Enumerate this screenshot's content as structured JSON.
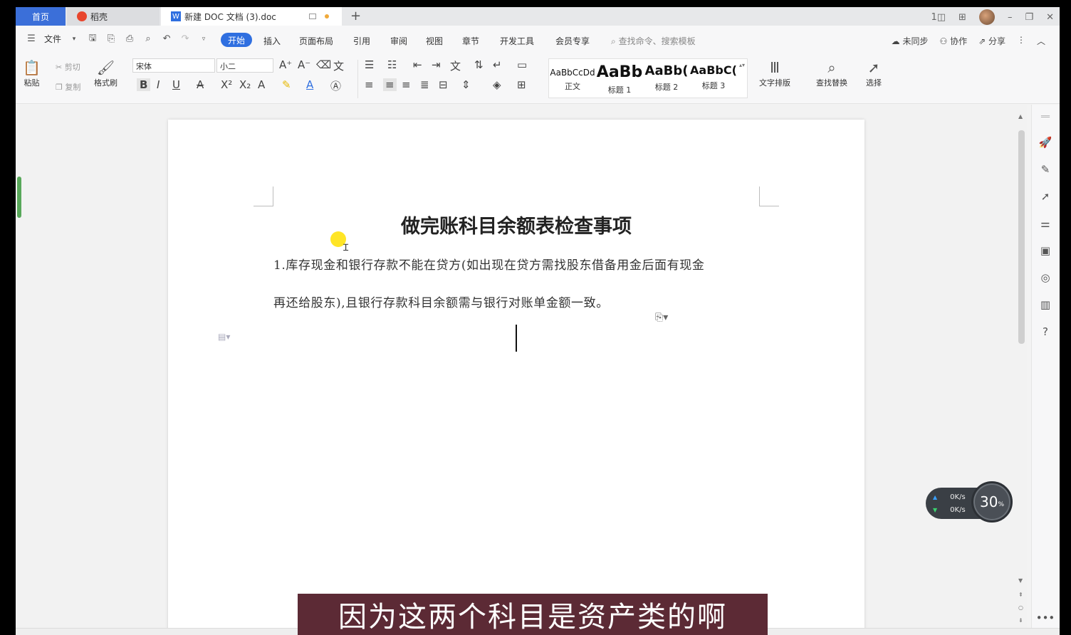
{
  "tabs": {
    "home": "首页",
    "daoke": "稻壳",
    "document": "新建 DOC 文档 (3).doc",
    "document_icon": "W",
    "add": "+"
  },
  "window": {
    "layout_icon": "1◫",
    "grid_icon": "⊞",
    "minimize": "–",
    "restore": "❐",
    "close": "✕"
  },
  "menu": {
    "file": "文件",
    "start": "开始",
    "items": [
      "插入",
      "页面布局",
      "引用",
      "审阅",
      "视图",
      "章节",
      "开发工具",
      "会员专享"
    ],
    "search_placeholder": "查找命令、搜索模板",
    "right": [
      "未同步",
      "协作",
      "分享"
    ]
  },
  "ribbon": {
    "paste": "粘贴",
    "cut": "剪切",
    "copy": "复制",
    "format_painter": "格式刷",
    "font_name": "宋体",
    "font_size": "小二",
    "bold": "B",
    "italic": "I",
    "underline": "U",
    "styles": [
      {
        "sample": "AaBbCcDd",
        "name": "正文"
      },
      {
        "sample": "AaBb",
        "name": "标题 1"
      },
      {
        "sample": "AaBb(",
        "name": "标题 2"
      },
      {
        "sample": "AaBbC(",
        "name": "标题 3"
      }
    ],
    "text_layout": "文字排版",
    "find_replace": "查找替换",
    "select": "选择"
  },
  "document": {
    "title": "做完账科目余额表检查事项",
    "paragraph_line1": "1.库存现金和银行存款不能在贷方(如出现在贷方需找股东借备用金后面有现金",
    "paragraph_line2": "再还给股东),且银行存款科目余额需与银行对账单金额一致。"
  },
  "net_widget": {
    "upload": "0K/s",
    "download": "0K/s",
    "cpu_value": "30",
    "cpu_unit": "%"
  },
  "subtitle": "因为这两个科目是资产类的啊",
  "colors": {
    "accent": "#2f6fe0",
    "subtitle_bg": "#5c2a35",
    "highlight": "#ffe000"
  }
}
